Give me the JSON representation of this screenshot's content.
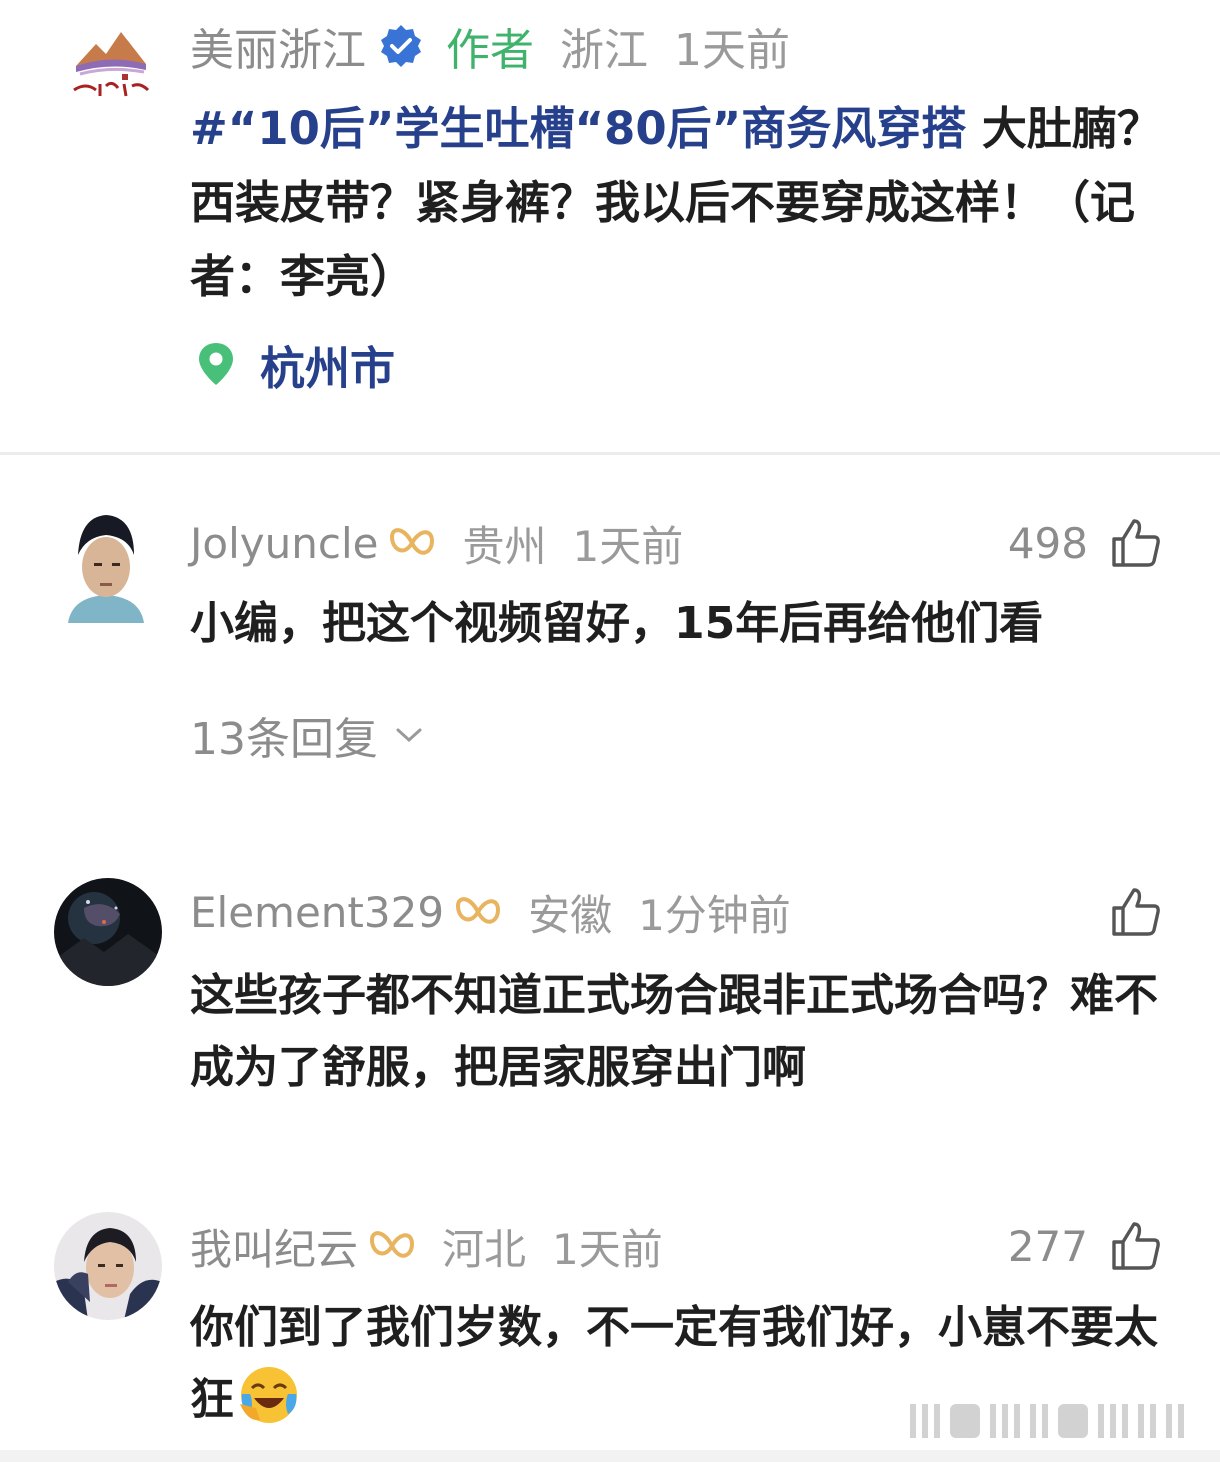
{
  "post": {
    "author": "美丽浙江",
    "author_tag": "作者",
    "region": "浙江",
    "time": "1天前",
    "hashtag": "#“10后”学生吐槽“80后”商务风穿搭",
    "body": " 大肚腩？西装皮带？紧身裤？我以后不要穿成这样！（记者：李亮）",
    "location": "杭州市"
  },
  "comments": [
    {
      "user": "Jolyuncle",
      "region": "贵州",
      "time": "1天前",
      "likes": "498",
      "text": "小编，把这个视频留好，15年后再给他们看",
      "replies": "13条回复"
    },
    {
      "user": "Element329",
      "region": "安徽",
      "time": "1分钟前",
      "likes": "",
      "text": "这些孩子都不知道正式场合跟非正式场合吗？难不成为了舒服，把居家服穿出门啊"
    },
    {
      "user": "我叫纪云",
      "region": "河北",
      "time": "1天前",
      "likes": "277",
      "text": "你们到了我们岁数，不一定有我们好，小崽不要太狂"
    }
  ],
  "colors": {
    "author_green": "#3fb36b",
    "link_blue": "#26408c",
    "badge_gold": "#e8b460",
    "meta_gray": "#8c8c8c"
  },
  "icons": [
    "verified-icon",
    "location-pin-icon",
    "member-badge-icon",
    "thumbs-up-icon",
    "chevron-down-icon",
    "laughing-crying-emoji-icon"
  ]
}
